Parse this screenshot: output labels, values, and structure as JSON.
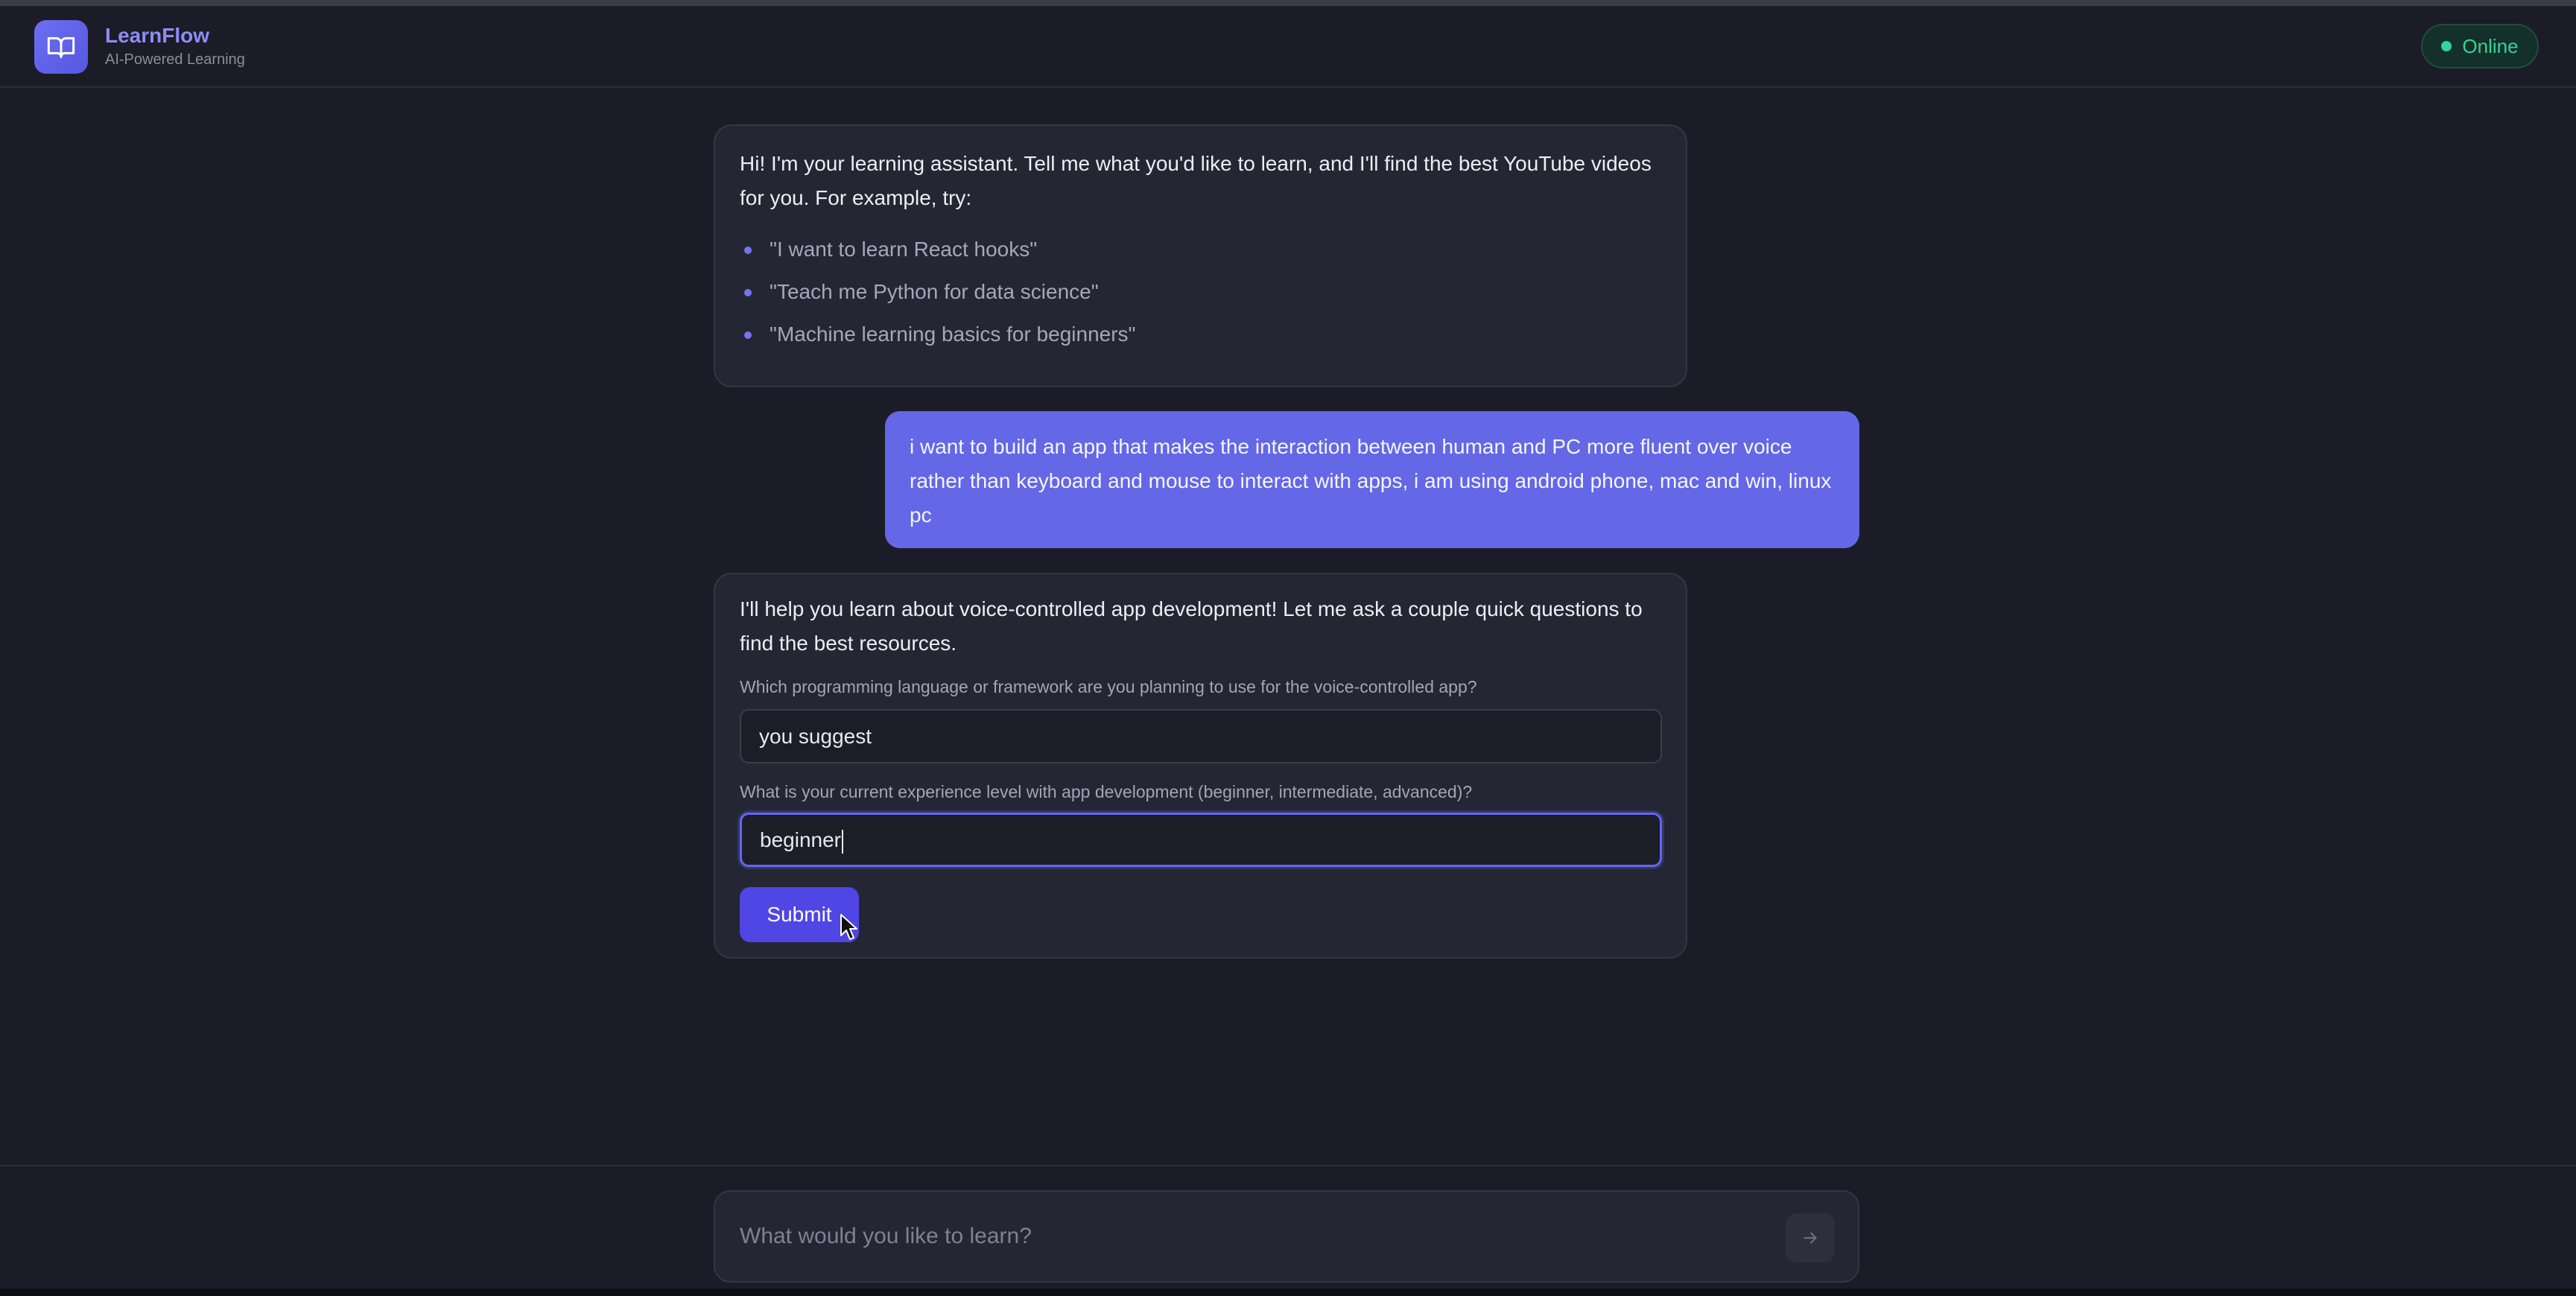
{
  "app": {
    "title": "LearnFlow",
    "subtitle": "AI-Powered Learning",
    "status": "Online",
    "accent_color": "#6366f1",
    "status_color": "#34d399"
  },
  "messages": {
    "greeting": {
      "text": "Hi! I'm your learning assistant. Tell me what you'd like to learn, and I'll find the best YouTube videos for you. For example, try:",
      "examples": [
        "\"I want to learn React hooks\"",
        "\"Teach me Python for data science\"",
        "\"Machine learning basics for beginners\""
      ]
    },
    "user": {
      "text": "i want to build an app that makes the interaction between human and PC more fluent over voice rather than keyboard and mouse to interact with apps, i am using android phone, mac and win, linux pc"
    },
    "followup": {
      "text": "I'll help you learn about voice-controlled app development! Let me ask a couple quick questions to find the best resources.",
      "question1": "Which programming language or framework are you planning to use for the voice-controlled app?",
      "answer1": "you suggest",
      "question2": "What is your current experience level with app development (beginner, intermediate, advanced)?",
      "answer2": "beginner",
      "submit_label": "Submit"
    }
  },
  "composer": {
    "placeholder": "What would you like to learn?"
  },
  "icons": {
    "logo": "book-open-icon",
    "send": "arrow-right-icon",
    "status": "status-dot-icon",
    "pointer": "mouse-pointer-icon"
  }
}
